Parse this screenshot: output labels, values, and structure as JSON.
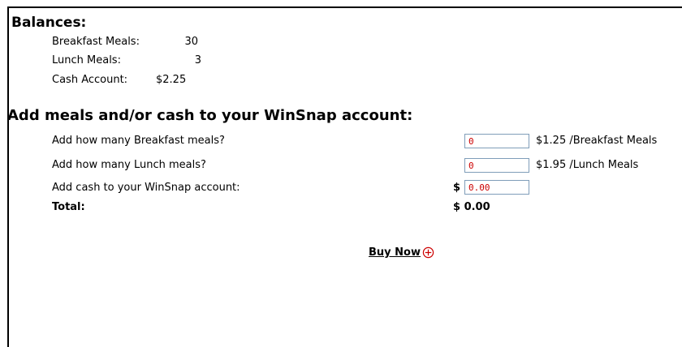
{
  "balances": {
    "title": "Balances:",
    "items": [
      {
        "label": "Breakfast Meals:",
        "value": "30"
      },
      {
        "label": "Lunch Meals:",
        "value": "3"
      },
      {
        "label": "Cash Account:",
        "value": "$2.25"
      }
    ]
  },
  "purchase": {
    "title": "Add meals and/or cash to your WinSnap account:",
    "breakfast": {
      "label": "Add how many Breakfast meals?",
      "value": "0",
      "price": "$1.25 /Breakfast Meals"
    },
    "lunch": {
      "label": "Add how many Lunch meals?",
      "value": "0",
      "price": "$1.95 /Lunch Meals"
    },
    "cash": {
      "label": "Add cash to your WinSnap account:",
      "currency": "$",
      "value": "0.00"
    },
    "total": {
      "label": "Total:",
      "value": "$ 0.00"
    },
    "buy_label": "Buy Now"
  },
  "colors": {
    "input_text": "#cc0000",
    "input_border": "#7f9db9",
    "icon": "#cc0000"
  },
  "icons": {
    "buy": "plus-circle-icon"
  }
}
